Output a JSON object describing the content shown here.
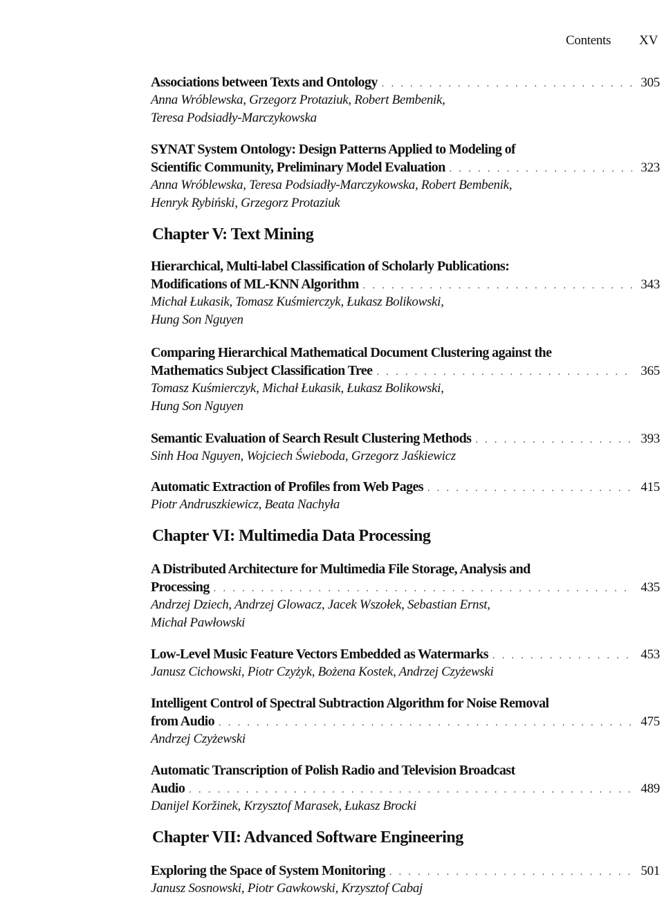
{
  "header": {
    "label": "Contents",
    "page": "XV"
  },
  "entries": [
    {
      "title_lines": [
        "Associations between Texts and Ontology"
      ],
      "page": "305",
      "authors_lines": [
        "Anna Wróblewska, Grzegorz Protaziuk, Robert Bembenik,",
        "Teresa Podsiadły-Marczykowska"
      ]
    },
    {
      "title_lines": [
        "SYNAT System Ontology: Design Patterns Applied to Modeling of",
        "Scientific Community, Preliminary Model Evaluation"
      ],
      "page": "323",
      "authors_lines": [
        "Anna Wróblewska, Teresa Podsiadły-Marczykowska, Robert Bembenik,",
        "Henryk Rybiński, Grzegorz Protaziuk"
      ]
    },
    {
      "title_lines": [
        "Hierarchical, Multi-label Classification of Scholarly Publications:",
        "Modifications of ML-KNN Algorithm"
      ],
      "page": "343",
      "authors_lines": [
        "Michał Łukasik, Tomasz Kuśmierczyk, Łukasz Bolikowski,",
        "Hung Son Nguyen"
      ]
    },
    {
      "title_lines": [
        "Comparing Hierarchical Mathematical Document Clustering against the",
        "Mathematics Subject Classification Tree"
      ],
      "page": "365",
      "authors_lines": [
        "Tomasz Kuśmierczyk, Michał Łukasik, Łukasz Bolikowski,",
        "Hung Son Nguyen"
      ]
    },
    {
      "title_lines": [
        "Semantic Evaluation of Search Result Clustering Methods"
      ],
      "page": "393",
      "authors_lines": [
        "Sinh Hoa Nguyen, Wojciech Świeboda, Grzegorz Jaśkiewicz"
      ]
    },
    {
      "title_lines": [
        "Automatic Extraction of Profiles from Web Pages"
      ],
      "page": "415",
      "authors_lines": [
        "Piotr Andruszkiewicz, Beata Nachyła"
      ]
    },
    {
      "title_lines": [
        "A Distributed Architecture for Multimedia File Storage, Analysis and",
        "Processing"
      ],
      "page": "435",
      "authors_lines": [
        "Andrzej Dziech, Andrzej Glowacz, Jacek Wszołek, Sebastian Ernst,",
        "Michał Pawłowski"
      ]
    },
    {
      "title_lines": [
        "Low-Level Music Feature Vectors Embedded as Watermarks"
      ],
      "page": "453",
      "authors_lines": [
        "Janusz Cichowski, Piotr Czyżyk, Bożena Kostek, Andrzej Czyżewski"
      ]
    },
    {
      "title_lines": [
        "Intelligent Control of Spectral Subtraction Algorithm for Noise Removal",
        "from Audio"
      ],
      "page": "475",
      "authors_lines": [
        "Andrzej Czyżewski"
      ]
    },
    {
      "title_lines": [
        "Automatic Transcription of Polish Radio and Television Broadcast",
        "Audio"
      ],
      "page": "489",
      "authors_lines": [
        "Danijel Koržinek, Krzysztof Marasek, Łukasz Brocki"
      ]
    },
    {
      "title_lines": [
        "Exploring the Space of System Monitoring"
      ],
      "page": "501",
      "authors_lines": [
        "Janusz Sosnowski, Piotr Gawkowski, Krzysztof Cabaj"
      ]
    }
  ],
  "chapters": {
    "ch5": "Chapter V: Text Mining",
    "ch6": "Chapter VI: Multimedia Data Processing",
    "ch7": "Chapter VII: Advanced Software Engineering"
  }
}
